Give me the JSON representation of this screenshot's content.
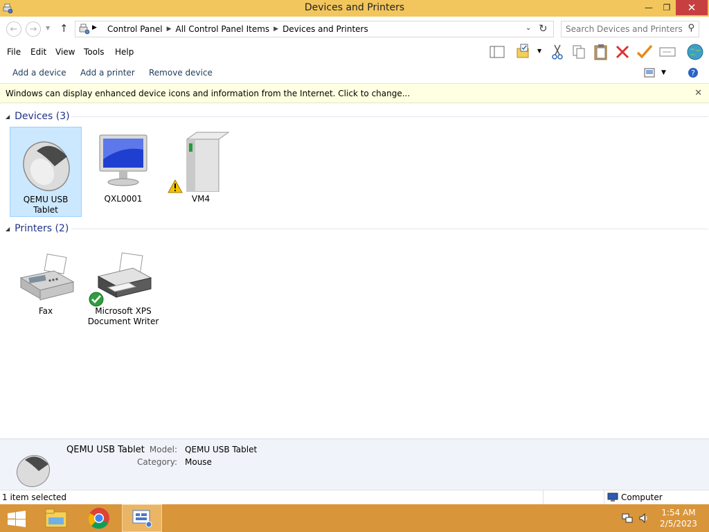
{
  "window": {
    "title": "Devices and Printers"
  },
  "address": {
    "crumbs": [
      "Control Panel",
      "All Control Panel Items",
      "Devices and Printers"
    ]
  },
  "search": {
    "placeholder": "Search Devices and Printers"
  },
  "menu": {
    "file": "File",
    "edit": "Edit",
    "view": "View",
    "tools": "Tools",
    "help": "Help"
  },
  "commands": {
    "add_device": "Add a device",
    "add_printer": "Add a printer",
    "remove_device": "Remove device"
  },
  "infobar": {
    "text": "Windows can display enhanced device icons and information from the Internet. Click to change..."
  },
  "groups": {
    "devices": {
      "label": "Devices (3)",
      "items": [
        {
          "line1": "QEMU USB",
          "line2": "Tablet"
        },
        {
          "line1": "QXL0001",
          "line2": ""
        },
        {
          "line1": "VM4",
          "line2": ""
        }
      ]
    },
    "printers": {
      "label": "Printers (2)",
      "items": [
        {
          "line1": "Fax",
          "line2": ""
        },
        {
          "line1": "Microsoft XPS",
          "line2": "Document Writer"
        }
      ]
    }
  },
  "details": {
    "name": "QEMU USB Tablet",
    "model_label": "Model:",
    "model_value": "QEMU USB Tablet",
    "category_label": "Category:",
    "category_value": "Mouse"
  },
  "status": {
    "selection": "1 item selected",
    "location": "Computer"
  },
  "taskbar": {
    "time": "1:54 AM",
    "date": "2/5/2023"
  },
  "colors": {
    "titlebar": "#f2c65d",
    "taskbar": "#d9953a",
    "selection": "#cce8ff",
    "group_header": "#1e3287"
  }
}
